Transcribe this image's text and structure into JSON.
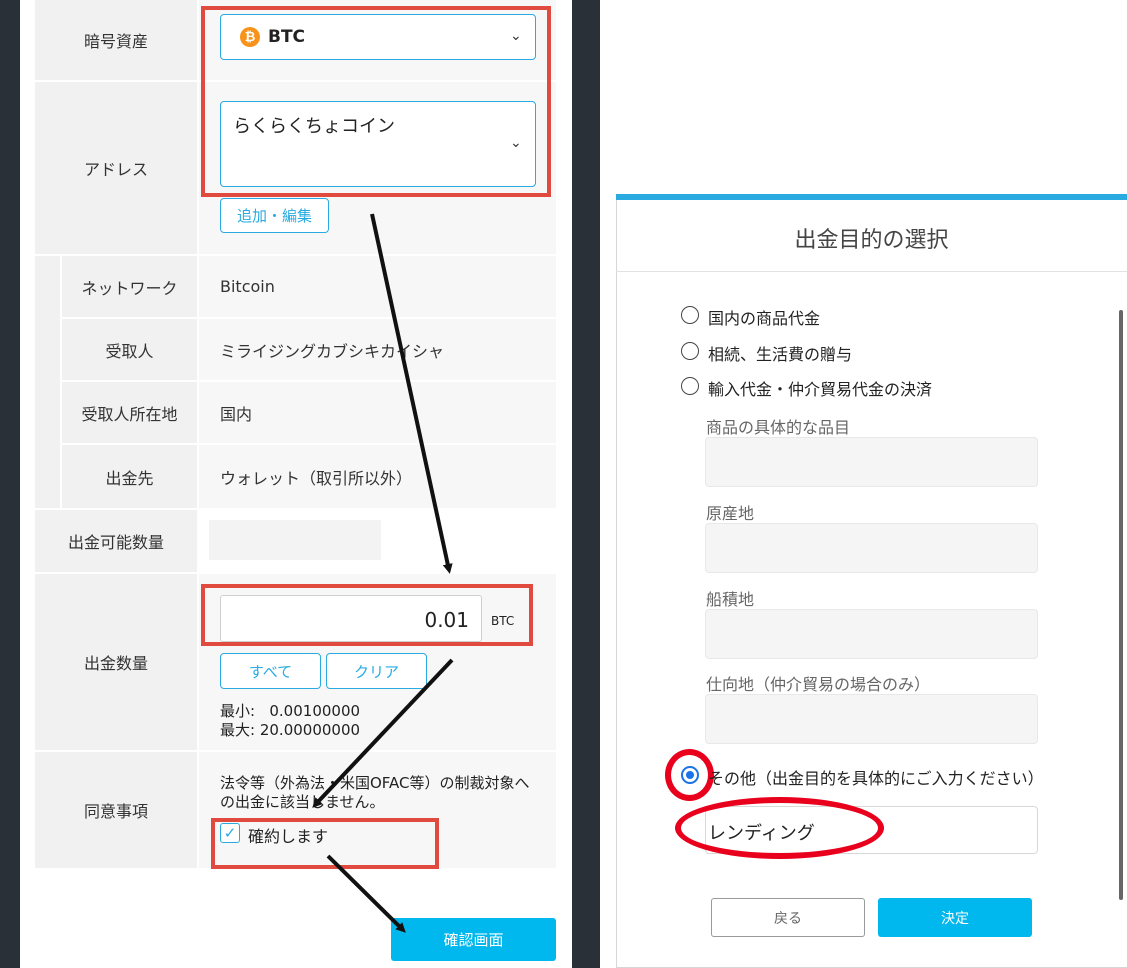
{
  "left": {
    "rows": {
      "asset_label": "暗号資産",
      "asset_value": "BTC",
      "asset_icon": "bitcoin-icon",
      "address_label": "アドレス",
      "address_value": "らくらくちょコイン",
      "address_edit_button": "追加・編集",
      "network_label": "ネットワーク",
      "network_value": "Bitcoin",
      "recipient_label": "受取人",
      "recipient_value": "ミライジングカブシキカイシャ",
      "recipient_location_label": "受取人所在地",
      "recipient_location_value": "国内",
      "destination_label": "出金先",
      "destination_value": "ウォレット（取引所以外）",
      "available_label": "出金可能数量",
      "amount_label": "出金数量",
      "amount_value": "0.01",
      "amount_unit": "BTC",
      "all_button": "すべて",
      "clear_button": "クリア",
      "min_label": "最小:",
      "min_value": "0.00100000",
      "max_label": "最大:",
      "max_value": "20.00000000",
      "consent_label": "同意事項",
      "consent_text": "法令等（外為法・米国OFAC等）の制裁対象への出金に該当しません。",
      "consent_checkbox_label": "確約します",
      "confirm_button": "確認画面"
    },
    "accent_color": "#29abe2",
    "highlight_color": "#e04a3f"
  },
  "modal": {
    "title": "出金目的の選択",
    "options": [
      {
        "label": "国内の商品代金",
        "checked": false
      },
      {
        "label": "相続、生活費の贈与",
        "checked": false
      },
      {
        "label": "輸入代金・仲介貿易代金の決済",
        "checked": false
      }
    ],
    "fields": [
      {
        "label": "商品の具体的な品目"
      },
      {
        "label": "原産地"
      },
      {
        "label": "船積地"
      },
      {
        "label": "仕向地（仲介貿易の場合のみ）"
      }
    ],
    "other_option": {
      "label": "その他（出金目的を具体的にご入力ください）",
      "checked": true
    },
    "other_input_value": "レンディング",
    "back_button": "戻る",
    "decide_button": "決定",
    "highlight_color": "#e8001c"
  }
}
